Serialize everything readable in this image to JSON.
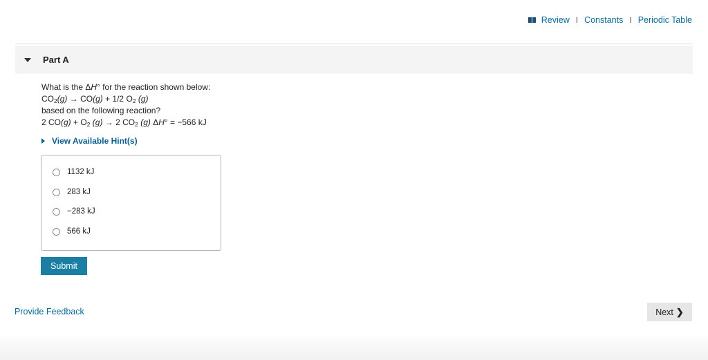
{
  "toplinks": {
    "review": "Review",
    "separator": "I",
    "constants": "Constants",
    "periodic_table": "Periodic Table",
    "icon": "book-icon"
  },
  "part": {
    "title": "Part A"
  },
  "question": {
    "line1_prefix": "What is the Δ",
    "line1_h": "H",
    "line1_deg": "°",
    "line1_suffix": " for the reaction shown below:",
    "eq1": {
      "co2": "CO",
      "co2_sub": "2",
      "g1": "(g)",
      "arrow": " → ",
      "co": "CO",
      "g2": "(g)",
      "plus": " + 1/2 O",
      "o2_sub": "2",
      "g3": " (g)"
    },
    "line3": "based on the following reaction?",
    "eq2": {
      "lead": "2 CO",
      "g1": "(g)",
      "plus": " + O",
      "o2_sub": "2",
      "g2": " (g)",
      "arrow": " → ",
      "co2": "2 CO",
      "co2_sub": "2",
      "g3": " (g)",
      "dh": " Δ",
      "h": "H",
      "deg": "°",
      "value": " = −566 kJ"
    }
  },
  "hint": {
    "label": "View Available Hint(s)"
  },
  "choices": [
    "1132 kJ",
    "283 kJ",
    "−283 kJ",
    "566 kJ"
  ],
  "buttons": {
    "submit": "Submit",
    "next": "Next",
    "next_chevron": "❯"
  },
  "footer": {
    "feedback": "Provide Feedback"
  }
}
